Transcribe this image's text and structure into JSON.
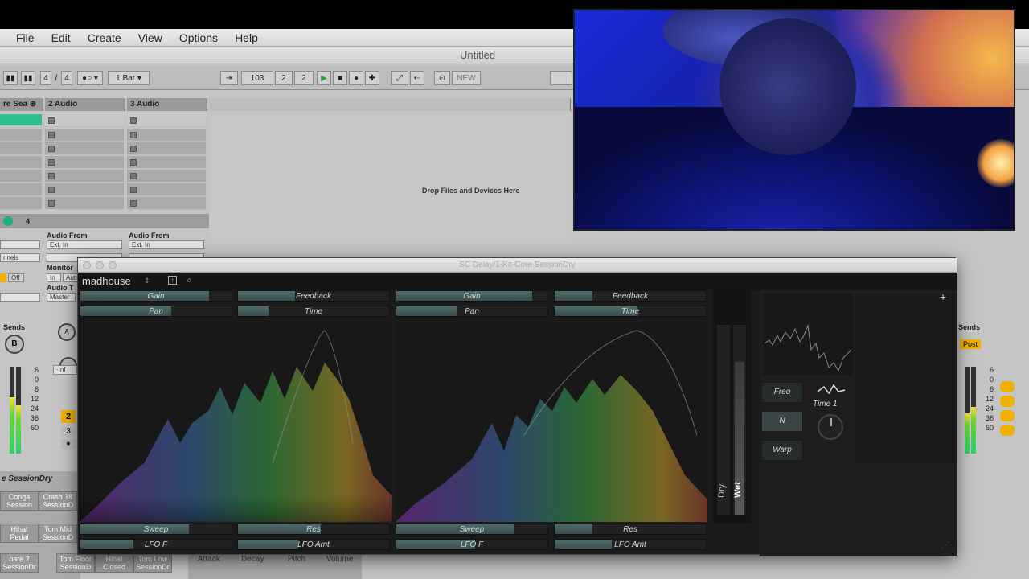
{
  "menu": [
    "File",
    "Edit",
    "Create",
    "View",
    "Options",
    "Help"
  ],
  "window_title": "Untitled",
  "transport": {
    "signature_num": "4",
    "signature_den": "4",
    "quantize": "1 Bar",
    "position_bar": "103",
    "position_beat": "2",
    "position_sixteenth": "2",
    "new_label": "NEW"
  },
  "tracks": {
    "headers": [
      "re Sea",
      "2 Audio",
      "3 Audio"
    ],
    "drop_text": "Drop Files and Devices Here",
    "audio_from": "Audio From",
    "ext_in": "Ext. In",
    "monitor": "Monitor",
    "in_label": "In",
    "auto_label": "Auto",
    "off_label": "Off",
    "audio_to": "Audio T",
    "master": "Master",
    "channels": "nnels",
    "sends": "Sends",
    "post": "Post",
    "track_num": "4",
    "track_2": "2",
    "track_3": "3",
    "inf": "-Inf",
    "db_scale": [
      "6",
      "0",
      "6",
      "12",
      "24",
      "36",
      "60"
    ]
  },
  "browser": {
    "session_name": "e SessionDry",
    "drums": [
      {
        "line1": "Conga",
        "line2": "Session"
      },
      {
        "line1": "Crash 18",
        "line2": "SessionD"
      },
      {
        "line1": "Hihat",
        "line2": "Pedal"
      },
      {
        "line1": "Tom Mid",
        "line2": "SessionD"
      },
      {
        "line1": "nare 2",
        "line2": "SessionDr"
      },
      {
        "line1": "Tom Floor",
        "line2": "SessionD"
      },
      {
        "line1": "Hihat",
        "line2": "Closed"
      },
      {
        "line1": "Tom Low",
        "line2": "SessionDr"
      }
    ],
    "device_params": [
      "Attack",
      "Decay",
      "Pitch",
      "Volume"
    ]
  },
  "plugin": {
    "window_title": "SC Delay/1-Kit-Core SessionDry",
    "brand": "madhouse",
    "left": {
      "gain": "Gain",
      "feedback": "Feedback",
      "pan": "Pan",
      "time": "Time",
      "sweep": "Sweep",
      "res": "Res",
      "lfo_f": "LFO F",
      "lfo_amt": "LFO Amt",
      "gain_value": 0.85,
      "feedback_value": 0.38,
      "pan_value": 0.6,
      "time_value": 0.2,
      "sweep_value": 0.72,
      "res_value": 0.55,
      "lfo_f_value": 0.35,
      "lfo_amt_value": 0.4
    },
    "right": {
      "gain": "Gain",
      "feedback": "Feedback",
      "pan": "Pan",
      "time": "Time",
      "sweep": "Sweep",
      "res": "Res",
      "lfo_f": "LFO F",
      "lfo_amt": "LFO Amt",
      "gain_value": 0.9,
      "feedback_value": 0.25,
      "pan_value": 0.4,
      "time_value": 0.55,
      "sweep_value": 0.78,
      "res_value": 0.25,
      "lfo_f_value": 0.52,
      "lfo_amt_value": 0.38
    },
    "dry": "Dry",
    "wet": "Wet",
    "freq": "Freq",
    "n": "N",
    "warp": "Warp",
    "time1": "Time 1",
    "plus": "+"
  }
}
